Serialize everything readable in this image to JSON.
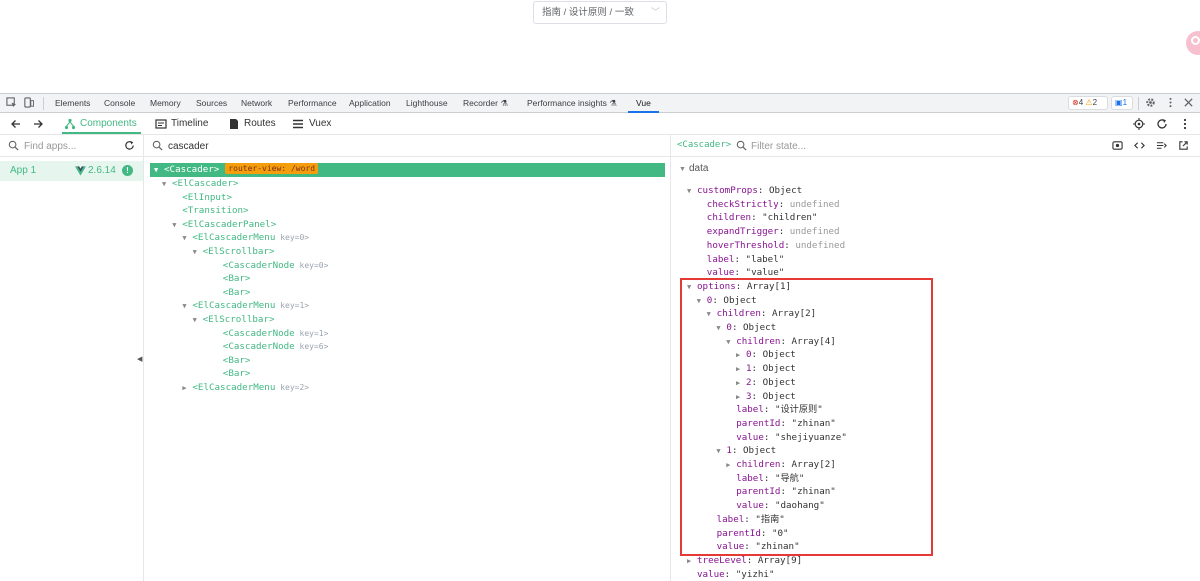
{
  "page": {
    "cascader_value": "指南 / 设计原则 / 一致"
  },
  "devtools_tabs": {
    "items": [
      "Elements",
      "Console",
      "Memory",
      "Sources",
      "Network",
      "Performance",
      "Application",
      "Lighthouse",
      "Recorder",
      "Performance insights",
      "Vue"
    ],
    "active": "Vue",
    "errors": "4",
    "warnings": "2",
    "messages": "1"
  },
  "vue_nav": {
    "components": "Components",
    "timeline": "Timeline",
    "routes": "Routes",
    "vuex": "Vuex"
  },
  "apps": {
    "search_placeholder": "Find apps...",
    "app_name": "App 1",
    "version": "2.6.14"
  },
  "tree": {
    "search_value": "cascader",
    "selected_label": "<Cascader>",
    "router_badge": "router-view: /word",
    "rows": [
      {
        "indent": 1,
        "arrow": "▼",
        "name": "<ElCascader>",
        "key": ""
      },
      {
        "indent": 2,
        "arrow": "",
        "name": "<ElInput>",
        "key": ""
      },
      {
        "indent": 2,
        "arrow": "",
        "name": "<Transition>",
        "key": ""
      },
      {
        "indent": 2,
        "arrow": "▼",
        "name": "<ElCascaderPanel>",
        "key": ""
      },
      {
        "indent": 3,
        "arrow": "▼",
        "name": "<ElCascaderMenu",
        "key": "key=0>"
      },
      {
        "indent": 4,
        "arrow": "▼",
        "name": "<ElScrollbar>",
        "key": ""
      },
      {
        "indent": 5,
        "arrow": "",
        "name": "<CascaderNode",
        "key": "key=0>"
      },
      {
        "indent": 5,
        "arrow": "",
        "name": "<Bar>",
        "key": ""
      },
      {
        "indent": 5,
        "arrow": "",
        "name": "<Bar>",
        "key": ""
      },
      {
        "indent": 3,
        "arrow": "▼",
        "name": "<ElCascaderMenu",
        "key": "key=1>"
      },
      {
        "indent": 4,
        "arrow": "▼",
        "name": "<ElScrollbar>",
        "key": ""
      },
      {
        "indent": 5,
        "arrow": "",
        "name": "<CascaderNode",
        "key": "key=1>"
      },
      {
        "indent": 5,
        "arrow": "",
        "name": "<CascaderNode",
        "key": "key=6>"
      },
      {
        "indent": 5,
        "arrow": "",
        "name": "<Bar>",
        "key": ""
      },
      {
        "indent": 5,
        "arrow": "",
        "name": "<Bar>",
        "key": ""
      },
      {
        "indent": 3,
        "arrow": "▶",
        "name": "<ElCascaderMenu",
        "key": "key=2>"
      }
    ]
  },
  "state": {
    "selected_component": "<Cascader>",
    "filter_placeholder": "Filter state...",
    "section": "data",
    "rows": [
      {
        "indent": 0,
        "arrow": "▼",
        "key": "customProps",
        "value": "Object",
        "vtype": "obj"
      },
      {
        "indent": 1,
        "arrow": "",
        "key": "checkStrictly",
        "value": "undefined",
        "vtype": "undef"
      },
      {
        "indent": 1,
        "arrow": "",
        "key": "children",
        "value": "\"children\"",
        "vtype": "str"
      },
      {
        "indent": 1,
        "arrow": "",
        "key": "expandTrigger",
        "value": "undefined",
        "vtype": "undef"
      },
      {
        "indent": 1,
        "arrow": "",
        "key": "hoverThreshold",
        "value": "undefined",
        "vtype": "undef"
      },
      {
        "indent": 1,
        "arrow": "",
        "key": "label",
        "value": "\"label\"",
        "vtype": "str"
      },
      {
        "indent": 1,
        "arrow": "",
        "key": "value",
        "value": "\"value\"",
        "vtype": "str"
      },
      {
        "indent": 0,
        "arrow": "▼",
        "key": "options",
        "value": "Array[1]",
        "vtype": "obj"
      },
      {
        "indent": 1,
        "arrow": "▼",
        "key": "0",
        "value": "Object",
        "vtype": "obj"
      },
      {
        "indent": 2,
        "arrow": "▼",
        "key": "children",
        "value": "Array[2]",
        "vtype": "obj"
      },
      {
        "indent": 3,
        "arrow": "▼",
        "key": "0",
        "value": "Object",
        "vtype": "obj"
      },
      {
        "indent": 4,
        "arrow": "▼",
        "key": "children",
        "value": "Array[4]",
        "vtype": "obj"
      },
      {
        "indent": 5,
        "arrow": "▶",
        "key": "0",
        "value": "Object",
        "vtype": "obj"
      },
      {
        "indent": 5,
        "arrow": "▶",
        "key": "1",
        "value": "Object",
        "vtype": "obj"
      },
      {
        "indent": 5,
        "arrow": "▶",
        "key": "2",
        "value": "Object",
        "vtype": "obj"
      },
      {
        "indent": 5,
        "arrow": "▶",
        "key": "3",
        "value": "Object",
        "vtype": "obj"
      },
      {
        "indent": 4,
        "arrow": "",
        "key": "label",
        "value": "\"设计原则\"",
        "vtype": "str"
      },
      {
        "indent": 4,
        "arrow": "",
        "key": "parentId",
        "value": "\"zhinan\"",
        "vtype": "str"
      },
      {
        "indent": 4,
        "arrow": "",
        "key": "value",
        "value": "\"shejiyuanze\"",
        "vtype": "str"
      },
      {
        "indent": 3,
        "arrow": "▼",
        "key": "1",
        "value": "Object",
        "vtype": "obj"
      },
      {
        "indent": 4,
        "arrow": "▶",
        "key": "children",
        "value": "Array[2]",
        "vtype": "obj"
      },
      {
        "indent": 4,
        "arrow": "",
        "key": "label",
        "value": "\"导航\"",
        "vtype": "str"
      },
      {
        "indent": 4,
        "arrow": "",
        "key": "parentId",
        "value": "\"zhinan\"",
        "vtype": "str"
      },
      {
        "indent": 4,
        "arrow": "",
        "key": "value",
        "value": "\"daohang\"",
        "vtype": "str"
      },
      {
        "indent": 2,
        "arrow": "",
        "key": "label",
        "value": "\"指南\"",
        "vtype": "str"
      },
      {
        "indent": 2,
        "arrow": "",
        "key": "parentId",
        "value": "\"0\"",
        "vtype": "str"
      },
      {
        "indent": 2,
        "arrow": "",
        "key": "value",
        "value": "\"zhinan\"",
        "vtype": "str"
      },
      {
        "indent": 0,
        "arrow": "▶",
        "key": "treeLevel",
        "value": "Array[9]",
        "vtype": "obj"
      },
      {
        "indent": 0,
        "arrow": "",
        "key": "value",
        "value": "\"yizhi\"",
        "vtype": "str"
      }
    ]
  },
  "colors": {
    "vue_green": "#42b883",
    "highlight_red": "#e53935",
    "badge_orange": "#f59e0b"
  }
}
